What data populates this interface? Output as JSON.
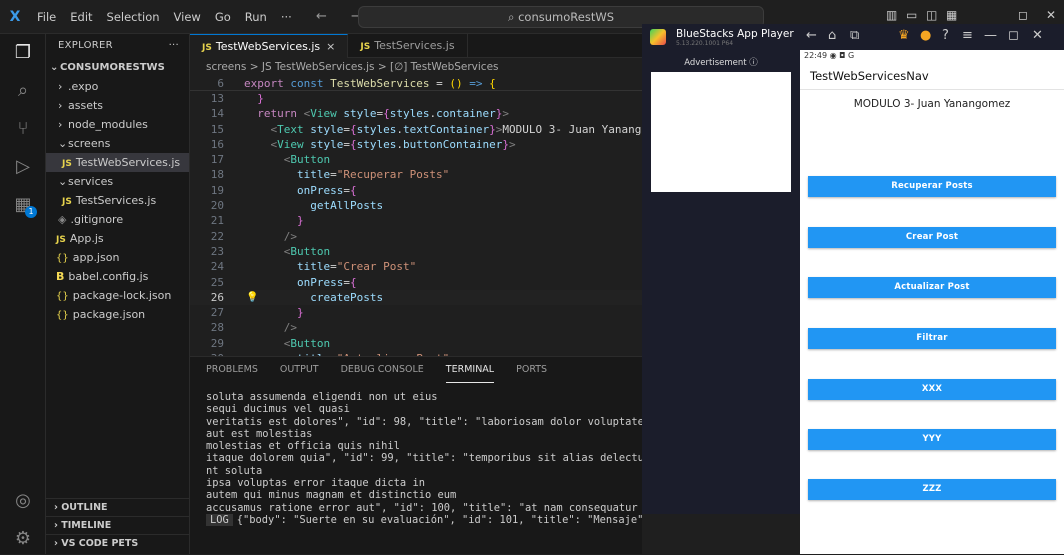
{
  "titlebar": {
    "logo": "X",
    "menu": [
      "File",
      "Edit",
      "Selection",
      "View",
      "Go",
      "Run",
      "···"
    ],
    "search": "consumoRestWS",
    "nav_back": "←",
    "nav_forward": "→"
  },
  "sidebar": {
    "header": "EXPLORER",
    "dots": "···",
    "root": "CONSUMORESTWS",
    "items": [
      {
        "label": ".expo"
      },
      {
        "label": "assets"
      },
      {
        "label": "node_modules"
      },
      {
        "label": "screens"
      },
      {
        "label": "TestWebServices.js"
      },
      {
        "label": "services"
      },
      {
        "label": "TestServices.js"
      },
      {
        "label": ".gitignore"
      },
      {
        "label": "App.js"
      },
      {
        "label": "app.json"
      },
      {
        "label": "babel.config.js"
      },
      {
        "label": "package-lock.json"
      },
      {
        "label": "package.json"
      }
    ],
    "outline": "OUTLINE",
    "timeline": "TIMELINE",
    "vscode_pets": "VS CODE PETS"
  },
  "editor": {
    "tabs": [
      {
        "label": "TestWebServices.js",
        "close": "×"
      },
      {
        "label": "TestServices.js"
      }
    ],
    "breadcrumb": "screens > JS TestWebServices.js > [∅] TestWebServices",
    "sticky_num": "6",
    "lines": [
      {
        "n": "13"
      },
      {
        "n": "14"
      },
      {
        "n": "15"
      },
      {
        "n": "16"
      },
      {
        "n": "17"
      },
      {
        "n": "18"
      },
      {
        "n": "19"
      },
      {
        "n": "20"
      },
      {
        "n": "21"
      },
      {
        "n": "22"
      },
      {
        "n": "23"
      },
      {
        "n": "24"
      },
      {
        "n": "25"
      },
      {
        "n": "26"
      },
      {
        "n": "27"
      },
      {
        "n": "28"
      },
      {
        "n": "29"
      },
      {
        "n": "30"
      }
    ]
  },
  "panel": {
    "tabs": [
      "PROBLEMS",
      "OUTPUT",
      "DEBUG CONSOLE",
      "TERMINAL",
      "PORTS"
    ],
    "active_tab": "TERMINAL",
    "lines": [
      "soluta assumenda eligendi non ut eius",
      "sequi ducimus vel quasi",
      "veritatis est dolores\", \"id\": 98, \"title\": \"laboriosam dolor voluptates\", \"user",
      "aut est molestias",
      "molestias et officia quis nihil",
      "itaque dolorem quia\", \"id\": 99, \"title\": \"temporibus sit alias delectus eligend",
      "nt soluta",
      "ipsa voluptas error itaque dicta in",
      "autem qui minus magnam et distinctio eum",
      "accusamus ratione error aut\", \"id\": 100, \"title\": \"at nam consequatur ea labore ea harum\", \"userId\": 10}]"
    ],
    "log_badge": "LOG",
    "log_line": "{\"body\": \"Suerte en su evaluación\", \"id\": 101, \"title\": \"Mensaje\", \"userId\": 1}"
  },
  "bluestacks": {
    "name": "BlueStacks App Player",
    "version": "5.13.220.1001 P64",
    "ad_label": "Advertisement ⓘ",
    "status_time": "22:49",
    "status_icons": "◉ ◘ G",
    "app_title": "TestWebServicesNav",
    "module_text": "MODULO 3- Juan Yanangomez",
    "buttons": [
      "Recuperar Posts",
      "Crear Post",
      "Actualizar Post",
      "Filtrar",
      "XXX",
      "YYY",
      "ZZZ"
    ]
  },
  "colors": {
    "accent": "#0078d4",
    "android_button": "#2196f3"
  }
}
